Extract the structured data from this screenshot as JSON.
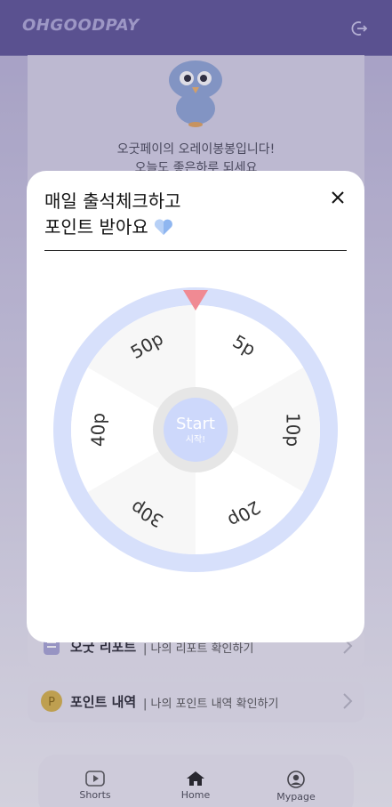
{
  "header": {
    "brand": "OHGOODPAY",
    "logout_icon": "logout-icon"
  },
  "greeting": {
    "line1": "오굿페이의 오레이봉봉입니다!",
    "line2": "오늘도 좋은하루 되세요"
  },
  "menu": [
    {
      "title": "오굿 리포트",
      "desc": "| 나의 리포트 확인하기",
      "icon": "report-icon"
    },
    {
      "title": "포인트 내역",
      "desc": "| 나의 포인트 내역 확인하기",
      "icon": "point-coin-icon"
    }
  ],
  "nav": [
    {
      "label": "Shorts",
      "icon": "play-icon"
    },
    {
      "label": "Home",
      "icon": "home-icon"
    },
    {
      "label": "Mypage",
      "icon": "user-icon"
    }
  ],
  "modal": {
    "title_line1": "매일 출석체크하고",
    "title_line2": "포인트 받아요",
    "close_icon": "close-icon",
    "wheel": {
      "segments": [
        "5p",
        "10p",
        "20p",
        "30p",
        "40p",
        "50p"
      ],
      "center_label": "Start",
      "center_sublabel": "시작!"
    }
  },
  "colors": {
    "header": "#5a5190",
    "wheel_ring": "#d7e0fb",
    "wheel_pointer": "#f08a93",
    "segment_light": "#f7f7f7",
    "segment_white": "#ffffff",
    "center_button": "#cdd8fb"
  }
}
